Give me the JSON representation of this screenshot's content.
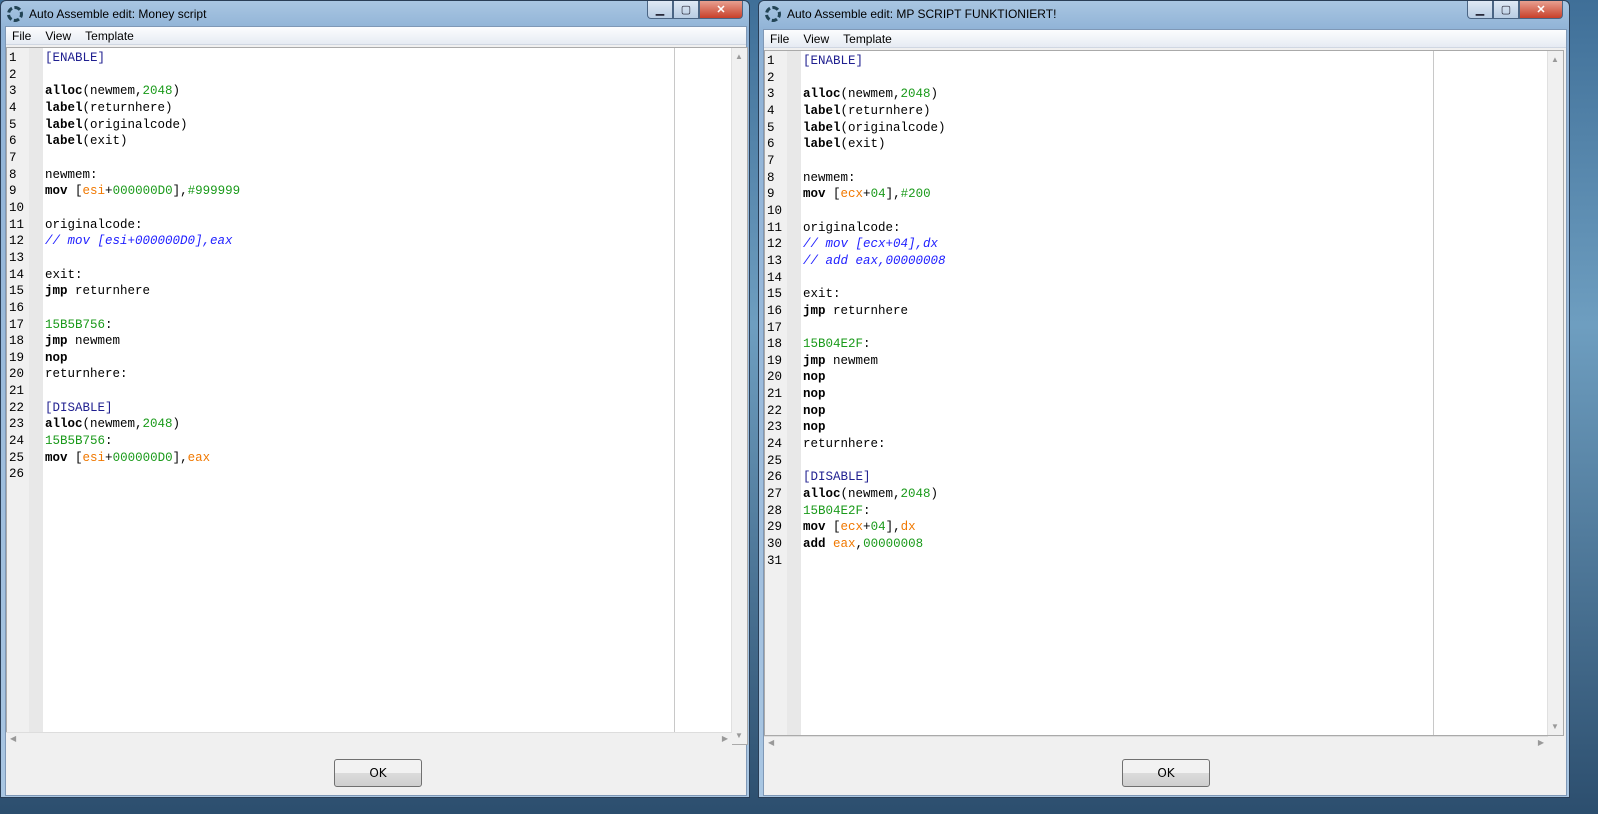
{
  "windows": [
    {
      "title": "Auto Assemble edit: Money script",
      "menu": [
        "File",
        "View",
        "Template"
      ],
      "ok_label": "OK",
      "code": [
        [
          [
            "[ENABLE]",
            "sec"
          ]
        ],
        [],
        [
          [
            "alloc",
            "kw"
          ],
          [
            "(newmem,",
            "plain"
          ],
          [
            "2048",
            "num"
          ],
          [
            ")",
            "plain"
          ]
        ],
        [
          [
            "label",
            "kw"
          ],
          [
            "(returnhere)",
            "plain"
          ]
        ],
        [
          [
            "label",
            "kw"
          ],
          [
            "(originalcode)",
            "plain"
          ]
        ],
        [
          [
            "label",
            "kw"
          ],
          [
            "(exit)",
            "plain"
          ]
        ],
        [],
        [
          [
            "newmem:",
            "plain"
          ]
        ],
        [
          [
            "mov",
            "kw"
          ],
          [
            " [",
            "plain"
          ],
          [
            "esi",
            "reg"
          ],
          [
            "+",
            "plain"
          ],
          [
            "000000D0",
            "num"
          ],
          [
            "],",
            "plain"
          ],
          [
            "#999999",
            "num"
          ]
        ],
        [],
        [
          [
            "originalcode:",
            "plain"
          ]
        ],
        [
          [
            "// mov [esi+000000D0],eax",
            "cmt"
          ]
        ],
        [],
        [
          [
            "exit:",
            "plain"
          ]
        ],
        [
          [
            "jmp",
            "kw"
          ],
          [
            " returnhere",
            "plain"
          ]
        ],
        [],
        [
          [
            "15B5B756",
            "num"
          ],
          [
            ":",
            "plain"
          ]
        ],
        [
          [
            "jmp",
            "kw"
          ],
          [
            " newmem",
            "plain"
          ]
        ],
        [
          [
            "nop",
            "kw"
          ]
        ],
        [
          [
            "returnhere:",
            "plain"
          ]
        ],
        [],
        [
          [
            "[DISABLE]",
            "sec"
          ]
        ],
        [
          [
            "alloc",
            "kw"
          ],
          [
            "(newmem,",
            "plain"
          ],
          [
            "2048",
            "num"
          ],
          [
            ")",
            "plain"
          ]
        ],
        [
          [
            "15B5B756",
            "num"
          ],
          [
            ":",
            "plain"
          ]
        ],
        [
          [
            "mov",
            "kw"
          ],
          [
            " [",
            "plain"
          ],
          [
            "esi",
            "reg"
          ],
          [
            "+",
            "plain"
          ],
          [
            "000000D0",
            "num"
          ],
          [
            "],",
            "plain"
          ],
          [
            "eax",
            "reg"
          ]
        ],
        []
      ]
    },
    {
      "title": "Auto Assemble edit: MP SCRIPT FUNKTIONIERT!",
      "menu": [
        "File",
        "View",
        "Template"
      ],
      "ok_label": "OK",
      "code": [
        [
          [
            "[ENABLE]",
            "sec"
          ]
        ],
        [],
        [
          [
            "alloc",
            "kw"
          ],
          [
            "(newmem,",
            "plain"
          ],
          [
            "2048",
            "num"
          ],
          [
            ")",
            "plain"
          ]
        ],
        [
          [
            "label",
            "kw"
          ],
          [
            "(returnhere)",
            "plain"
          ]
        ],
        [
          [
            "label",
            "kw"
          ],
          [
            "(originalcode)",
            "plain"
          ]
        ],
        [
          [
            "label",
            "kw"
          ],
          [
            "(exit)",
            "plain"
          ]
        ],
        [],
        [
          [
            "newmem:",
            "plain"
          ]
        ],
        [
          [
            "mov",
            "kw"
          ],
          [
            " [",
            "plain"
          ],
          [
            "ecx",
            "reg"
          ],
          [
            "+",
            "plain"
          ],
          [
            "04",
            "num"
          ],
          [
            "],",
            "plain"
          ],
          [
            "#200",
            "num"
          ]
        ],
        [],
        [
          [
            "originalcode:",
            "plain"
          ]
        ],
        [
          [
            "// mov [ecx+04],dx",
            "cmt"
          ]
        ],
        [
          [
            "// add eax,00000008",
            "cmt"
          ]
        ],
        [],
        [
          [
            "exit:",
            "plain"
          ]
        ],
        [
          [
            "jmp",
            "kw"
          ],
          [
            " returnhere",
            "plain"
          ]
        ],
        [],
        [
          [
            "15B04E2F",
            "num"
          ],
          [
            ":",
            "plain"
          ]
        ],
        [
          [
            "jmp",
            "kw"
          ],
          [
            " newmem",
            "plain"
          ]
        ],
        [
          [
            "nop",
            "kw"
          ]
        ],
        [
          [
            "nop",
            "kw"
          ]
        ],
        [
          [
            "nop",
            "kw"
          ]
        ],
        [
          [
            "nop",
            "kw"
          ]
        ],
        [
          [
            "returnhere:",
            "plain"
          ]
        ],
        [],
        [
          [
            "[DISABLE]",
            "sec"
          ]
        ],
        [
          [
            "alloc",
            "kw"
          ],
          [
            "(newmem,",
            "plain"
          ],
          [
            "2048",
            "num"
          ],
          [
            ")",
            "plain"
          ]
        ],
        [
          [
            "15B04E2F",
            "num"
          ],
          [
            ":",
            "plain"
          ]
        ],
        [
          [
            "mov",
            "kw"
          ],
          [
            " [",
            "plain"
          ],
          [
            "ecx",
            "reg"
          ],
          [
            "+",
            "plain"
          ],
          [
            "04",
            "num"
          ],
          [
            "],",
            "plain"
          ],
          [
            "dx",
            "reg"
          ]
        ],
        [
          [
            "add",
            "kw"
          ],
          [
            " ",
            "plain"
          ],
          [
            "eax",
            "reg"
          ],
          [
            ",",
            "plain"
          ],
          [
            "00000008",
            "num"
          ]
        ],
        []
      ]
    }
  ]
}
